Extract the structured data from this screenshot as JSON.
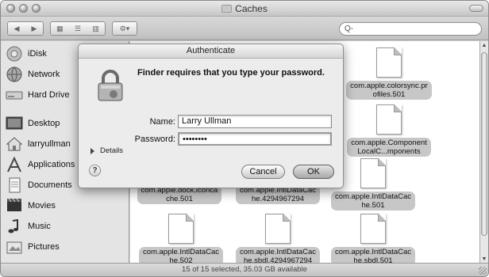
{
  "window": {
    "title": "Caches"
  },
  "toolbar": {
    "search_value": "Q-"
  },
  "sidebar": {
    "items": [
      {
        "label": "iDisk"
      },
      {
        "label": "Network"
      },
      {
        "label": "Hard Drive"
      },
      {
        "label": "Desktop"
      },
      {
        "label": "larryullman"
      },
      {
        "label": "Applications"
      },
      {
        "label": "Documents"
      },
      {
        "label": "Movies"
      },
      {
        "label": "Music"
      },
      {
        "label": "Pictures"
      }
    ]
  },
  "files": [
    {
      "label_line1": "com.apple.colorsync.pr",
      "label_line2": "ofiles.501"
    },
    {
      "label_line1": "com.apple.Component",
      "label_line2": "LocalC...mponents"
    },
    {
      "label_line1": "com.apple.dock.iconca",
      "label_line2": "che.501"
    },
    {
      "label_line1": "com.apple.IntlDataCac",
      "label_line2": "he.4294967294"
    },
    {
      "label_line1": "com.apple.IntlDataCac",
      "label_line2": "he.501"
    },
    {
      "label_line1": "com.apple.IntlDataCac",
      "label_line2": "he.502"
    },
    {
      "label_line1": "com.apple.IntlDataCac",
      "label_line2": "he.sbdl.4294967294"
    },
    {
      "label_line1": "com.apple.IntlDataCac",
      "label_line2": "he.sbdl.501"
    }
  ],
  "status": {
    "text": "15 of 15 selected, 35.03 GB available"
  },
  "dialog": {
    "title": "Authenticate",
    "message": "Finder requires that you type your password.",
    "name_label": "Name:",
    "name_value": "Larry Ullman",
    "password_label": "Password:",
    "password_value": "••••••••",
    "details_label": "Details",
    "help_label": "?",
    "cancel_label": "Cancel",
    "ok_label": "OK"
  }
}
